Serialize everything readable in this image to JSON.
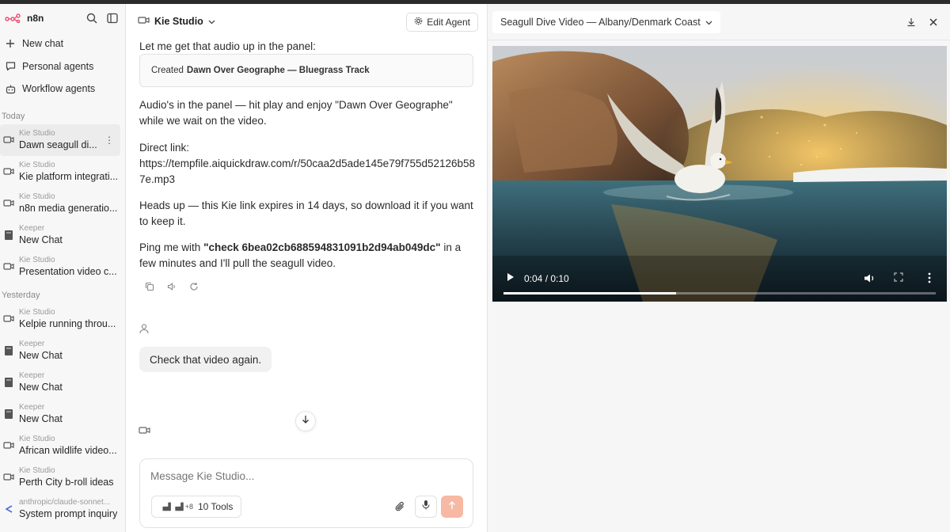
{
  "app": {
    "name": "n8n"
  },
  "sidebar": {
    "nav": [
      {
        "label": "New chat",
        "icon": "plus-icon"
      },
      {
        "label": "Personal agents",
        "icon": "chat-icon"
      },
      {
        "label": "Workflow agents",
        "icon": "robot-icon"
      }
    ],
    "sections": [
      {
        "label": "Today",
        "items": [
          {
            "agent": "Kie Studio",
            "title": "Dawn seagull di...",
            "icon": "video-icon",
            "active": true
          },
          {
            "agent": "Kie Studio",
            "title": "Kie platform integrati...",
            "icon": "video-icon"
          },
          {
            "agent": "Kie Studio",
            "title": "n8n media generatio...",
            "icon": "video-icon"
          },
          {
            "agent": "Keeper",
            "title": "New Chat",
            "icon": "book-icon"
          },
          {
            "agent": "Kie Studio",
            "title": "Presentation video c...",
            "icon": "video-icon"
          }
        ]
      },
      {
        "label": "Yesterday",
        "items": [
          {
            "agent": "Kie Studio",
            "title": "Kelpie running throu...",
            "icon": "video-icon"
          },
          {
            "agent": "Keeper",
            "title": "New Chat",
            "icon": "book-icon"
          },
          {
            "agent": "Keeper",
            "title": "New Chat",
            "icon": "book-icon"
          },
          {
            "agent": "Keeper",
            "title": "New Chat",
            "icon": "book-icon"
          },
          {
            "agent": "Kie Studio",
            "title": "African wildlife video...",
            "icon": "video-icon"
          },
          {
            "agent": "Kie Studio",
            "title": "Perth City b-roll ideas",
            "icon": "video-icon"
          },
          {
            "agent": "anthropic/claude-sonnet...",
            "title": "System prompt inquiry",
            "icon": "claude-icon"
          }
        ]
      }
    ]
  },
  "chat": {
    "agent_name": "Kie Studio",
    "edit_agent_label": "Edit Agent",
    "intro": "Let me get that audio up in the panel:",
    "created_prefix": "Created",
    "created_title": "Dawn Over Geographe — Bluegrass Track",
    "para1": "Audio's in the panel — hit play and enjoy \"Dawn Over Geographe\" while we wait on the video.",
    "direct_link_label": "Direct link:",
    "direct_link_url": "https://tempfile.aiquickdraw.com/r/50caa2d5ade145e79f755d52126b587e.mp3",
    "heads_up": "Heads up — this Kie link expires in 14 days, so download it if you want to keep it.",
    "ping_prefix": "Ping me with",
    "ping_code": "\"check 6bea02cb688594831091b2d94ab049dc\"",
    "ping_suffix": "in a few minutes and I'll pull the seagull video.",
    "user_message": "Check that video again.",
    "composer_placeholder": "Message Kie Studio...",
    "tools_extra": "+8",
    "tools_label": "10 Tools"
  },
  "panel": {
    "title": "Seagull Dive Video — Albany/Denmark Coast",
    "video": {
      "time_display": "0:04 / 0:10",
      "progress": 0.4
    }
  },
  "colors": {
    "accent": "#f7b8a4",
    "brand": "#ea4b71"
  }
}
